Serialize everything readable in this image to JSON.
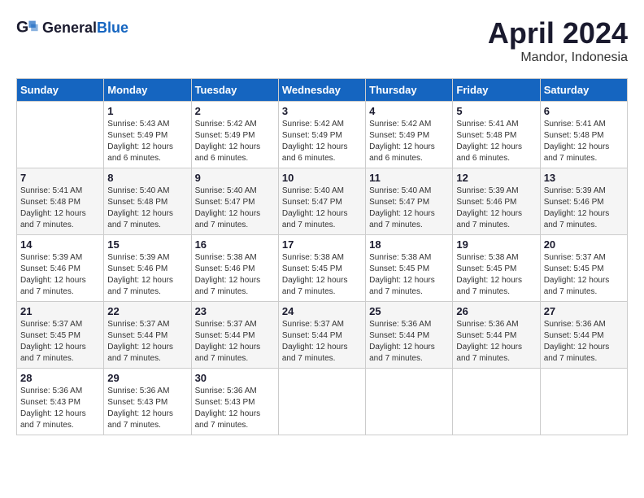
{
  "header": {
    "logo_general": "General",
    "logo_blue": "Blue",
    "title": "April 2024",
    "subtitle": "Mandor, Indonesia"
  },
  "weekdays": [
    "Sunday",
    "Monday",
    "Tuesday",
    "Wednesday",
    "Thursday",
    "Friday",
    "Saturday"
  ],
  "weeks": [
    [
      {
        "day": "",
        "info": ""
      },
      {
        "day": "1",
        "info": "Sunrise: 5:43 AM\nSunset: 5:49 PM\nDaylight: 12 hours\nand 6 minutes."
      },
      {
        "day": "2",
        "info": "Sunrise: 5:42 AM\nSunset: 5:49 PM\nDaylight: 12 hours\nand 6 minutes."
      },
      {
        "day": "3",
        "info": "Sunrise: 5:42 AM\nSunset: 5:49 PM\nDaylight: 12 hours\nand 6 minutes."
      },
      {
        "day": "4",
        "info": "Sunrise: 5:42 AM\nSunset: 5:49 PM\nDaylight: 12 hours\nand 6 minutes."
      },
      {
        "day": "5",
        "info": "Sunrise: 5:41 AM\nSunset: 5:48 PM\nDaylight: 12 hours\nand 6 minutes."
      },
      {
        "day": "6",
        "info": "Sunrise: 5:41 AM\nSunset: 5:48 PM\nDaylight: 12 hours\nand 7 minutes."
      }
    ],
    [
      {
        "day": "7",
        "info": "Sunrise: 5:41 AM\nSunset: 5:48 PM\nDaylight: 12 hours\nand 7 minutes."
      },
      {
        "day": "8",
        "info": "Sunrise: 5:40 AM\nSunset: 5:48 PM\nDaylight: 12 hours\nand 7 minutes."
      },
      {
        "day": "9",
        "info": "Sunrise: 5:40 AM\nSunset: 5:47 PM\nDaylight: 12 hours\nand 7 minutes."
      },
      {
        "day": "10",
        "info": "Sunrise: 5:40 AM\nSunset: 5:47 PM\nDaylight: 12 hours\nand 7 minutes."
      },
      {
        "day": "11",
        "info": "Sunrise: 5:40 AM\nSunset: 5:47 PM\nDaylight: 12 hours\nand 7 minutes."
      },
      {
        "day": "12",
        "info": "Sunrise: 5:39 AM\nSunset: 5:46 PM\nDaylight: 12 hours\nand 7 minutes."
      },
      {
        "day": "13",
        "info": "Sunrise: 5:39 AM\nSunset: 5:46 PM\nDaylight: 12 hours\nand 7 minutes."
      }
    ],
    [
      {
        "day": "14",
        "info": "Sunrise: 5:39 AM\nSunset: 5:46 PM\nDaylight: 12 hours\nand 7 minutes."
      },
      {
        "day": "15",
        "info": "Sunrise: 5:39 AM\nSunset: 5:46 PM\nDaylight: 12 hours\nand 7 minutes."
      },
      {
        "day": "16",
        "info": "Sunrise: 5:38 AM\nSunset: 5:46 PM\nDaylight: 12 hours\nand 7 minutes."
      },
      {
        "day": "17",
        "info": "Sunrise: 5:38 AM\nSunset: 5:45 PM\nDaylight: 12 hours\nand 7 minutes."
      },
      {
        "day": "18",
        "info": "Sunrise: 5:38 AM\nSunset: 5:45 PM\nDaylight: 12 hours\nand 7 minutes."
      },
      {
        "day": "19",
        "info": "Sunrise: 5:38 AM\nSunset: 5:45 PM\nDaylight: 12 hours\nand 7 minutes."
      },
      {
        "day": "20",
        "info": "Sunrise: 5:37 AM\nSunset: 5:45 PM\nDaylight: 12 hours\nand 7 minutes."
      }
    ],
    [
      {
        "day": "21",
        "info": "Sunrise: 5:37 AM\nSunset: 5:45 PM\nDaylight: 12 hours\nand 7 minutes."
      },
      {
        "day": "22",
        "info": "Sunrise: 5:37 AM\nSunset: 5:44 PM\nDaylight: 12 hours\nand 7 minutes."
      },
      {
        "day": "23",
        "info": "Sunrise: 5:37 AM\nSunset: 5:44 PM\nDaylight: 12 hours\nand 7 minutes."
      },
      {
        "day": "24",
        "info": "Sunrise: 5:37 AM\nSunset: 5:44 PM\nDaylight: 12 hours\nand 7 minutes."
      },
      {
        "day": "25",
        "info": "Sunrise: 5:36 AM\nSunset: 5:44 PM\nDaylight: 12 hours\nand 7 minutes."
      },
      {
        "day": "26",
        "info": "Sunrise: 5:36 AM\nSunset: 5:44 PM\nDaylight: 12 hours\nand 7 minutes."
      },
      {
        "day": "27",
        "info": "Sunrise: 5:36 AM\nSunset: 5:44 PM\nDaylight: 12 hours\nand 7 minutes."
      }
    ],
    [
      {
        "day": "28",
        "info": "Sunrise: 5:36 AM\nSunset: 5:43 PM\nDaylight: 12 hours\nand 7 minutes."
      },
      {
        "day": "29",
        "info": "Sunrise: 5:36 AM\nSunset: 5:43 PM\nDaylight: 12 hours\nand 7 minutes."
      },
      {
        "day": "30",
        "info": "Sunrise: 5:36 AM\nSunset: 5:43 PM\nDaylight: 12 hours\nand 7 minutes."
      },
      {
        "day": "",
        "info": ""
      },
      {
        "day": "",
        "info": ""
      },
      {
        "day": "",
        "info": ""
      },
      {
        "day": "",
        "info": ""
      }
    ]
  ]
}
